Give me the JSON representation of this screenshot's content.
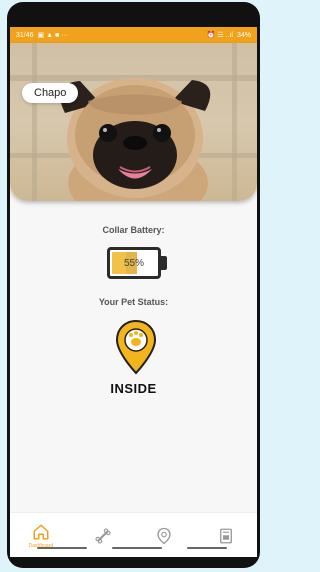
{
  "status_bar": {
    "time": "31/46",
    "battery": "34%"
  },
  "pet": {
    "name": "Chapo",
    "image": "pug-photo"
  },
  "battery": {
    "label": "Collar Battery:",
    "percent_text": "55%",
    "level": 0.55
  },
  "pet_status": {
    "label": "Your Pet Status:",
    "value": "INSIDE"
  },
  "nav": {
    "items": [
      {
        "icon": "home-icon",
        "label": "Dashboard",
        "active": true
      },
      {
        "icon": "bone-icon",
        "label": ""
      },
      {
        "icon": "location-pin-icon",
        "label": ""
      },
      {
        "icon": "report-icon",
        "label": ""
      }
    ]
  },
  "colors": {
    "accent": "#f2a21a",
    "battery_fill": "#f2c14a",
    "status_pin": "#f2b51e"
  }
}
